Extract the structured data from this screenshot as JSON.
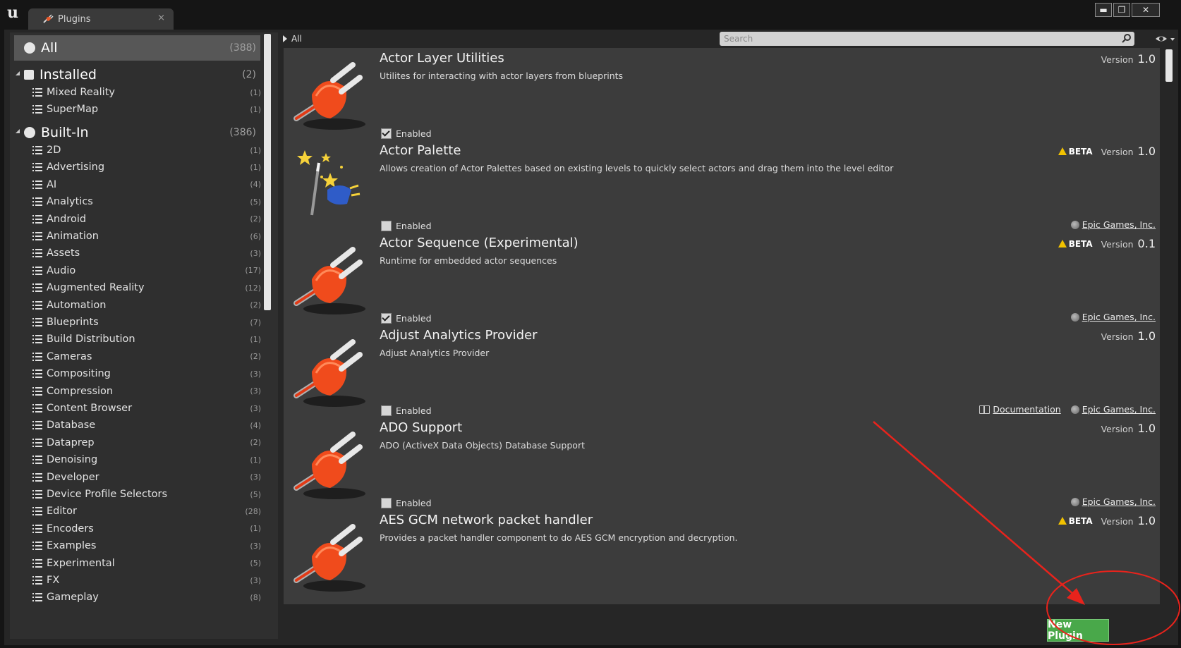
{
  "window": {
    "tab_title": "Plugins",
    "tab_close": "×",
    "minimize": "▬",
    "maximize": "❐",
    "close": "✕"
  },
  "sidebar": {
    "all": {
      "label": "All",
      "count": "(388)"
    },
    "installed": {
      "label": "Installed",
      "count": "(2)"
    },
    "installed_items": [
      {
        "label": "Mixed Reality",
        "count": "(1)"
      },
      {
        "label": "SuperMap",
        "count": "(1)"
      }
    ],
    "builtin": {
      "label": "Built-In",
      "count": "(386)"
    },
    "builtin_items": [
      {
        "label": "2D",
        "count": "(1)"
      },
      {
        "label": "Advertising",
        "count": "(1)"
      },
      {
        "label": "AI",
        "count": "(4)"
      },
      {
        "label": "Analytics",
        "count": "(5)"
      },
      {
        "label": "Android",
        "count": "(2)"
      },
      {
        "label": "Animation",
        "count": "(6)"
      },
      {
        "label": "Assets",
        "count": "(3)"
      },
      {
        "label": "Audio",
        "count": "(17)"
      },
      {
        "label": "Augmented Reality",
        "count": "(12)"
      },
      {
        "label": "Automation",
        "count": "(2)"
      },
      {
        "label": "Blueprints",
        "count": "(7)"
      },
      {
        "label": "Build Distribution",
        "count": "(1)"
      },
      {
        "label": "Cameras",
        "count": "(2)"
      },
      {
        "label": "Compositing",
        "count": "(3)"
      },
      {
        "label": "Compression",
        "count": "(3)"
      },
      {
        "label": "Content Browser",
        "count": "(3)"
      },
      {
        "label": "Database",
        "count": "(4)"
      },
      {
        "label": "Dataprep",
        "count": "(2)"
      },
      {
        "label": "Denoising",
        "count": "(1)"
      },
      {
        "label": "Developer",
        "count": "(3)"
      },
      {
        "label": "Device Profile Selectors",
        "count": "(5)"
      },
      {
        "label": "Editor",
        "count": "(28)"
      },
      {
        "label": "Encoders",
        "count": "(1)"
      },
      {
        "label": "Examples",
        "count": "(3)"
      },
      {
        "label": "Experimental",
        "count": "(5)"
      },
      {
        "label": "FX",
        "count": "(3)"
      },
      {
        "label": "Gameplay",
        "count": "(8)"
      }
    ]
  },
  "breadcrumb": {
    "label": "All"
  },
  "search": {
    "placeholder": "Search",
    "value": ""
  },
  "plugins": [
    {
      "name": "Actor Layer Utilities",
      "desc": "Utilites for interacting with actor layers from blueprints",
      "enabled_label": "Enabled",
      "enabled": true,
      "beta": "",
      "version_label": "Version",
      "version": "1.0",
      "doc": "",
      "vendor": "",
      "icon": "plug-icon"
    },
    {
      "name": "Actor Palette",
      "desc": "Allows creation of Actor Palettes based on existing levels to quickly select actors and drag them into the level editor",
      "enabled_label": "Enabled",
      "enabled": false,
      "beta": "BETA",
      "version_label": "Version",
      "version": "1.0",
      "doc": "",
      "vendor": "Epic Games, Inc.",
      "icon": "magic-wand-plug-icon"
    },
    {
      "name": "Actor Sequence (Experimental)",
      "desc": "Runtime for embedded actor sequences",
      "enabled_label": "Enabled",
      "enabled": true,
      "beta": "BETA",
      "version_label": "Version",
      "version": "0.1",
      "doc": "",
      "vendor": "Epic Games, Inc.",
      "icon": "plug-icon"
    },
    {
      "name": "Adjust Analytics Provider",
      "desc": "Adjust Analytics Provider",
      "enabled_label": "Enabled",
      "enabled": false,
      "beta": "",
      "version_label": "Version",
      "version": "1.0",
      "doc": "Documentation",
      "vendor": "Epic Games, Inc.",
      "icon": "plug-icon"
    },
    {
      "name": "ADO Support",
      "desc": "ADO (ActiveX Data Objects) Database Support",
      "enabled_label": "Enabled",
      "enabled": false,
      "beta": "",
      "version_label": "Version",
      "version": "1.0",
      "doc": "",
      "vendor": "Epic Games, Inc.",
      "icon": "plug-icon"
    },
    {
      "name": "AES GCM network packet handler",
      "desc": "Provides a packet handler component to do AES GCM encryption and decryption.",
      "enabled_label": "",
      "enabled": false,
      "beta": "BETA",
      "version_label": "Version",
      "version": "1.0",
      "doc": "",
      "vendor": "",
      "icon": "plug-icon"
    }
  ],
  "footer": {
    "new_plugin": "New Plugin"
  },
  "colors": {
    "accent_green": "#49a84a",
    "annotation_red": "#e8231c",
    "beta_warning": "#f2c200"
  }
}
